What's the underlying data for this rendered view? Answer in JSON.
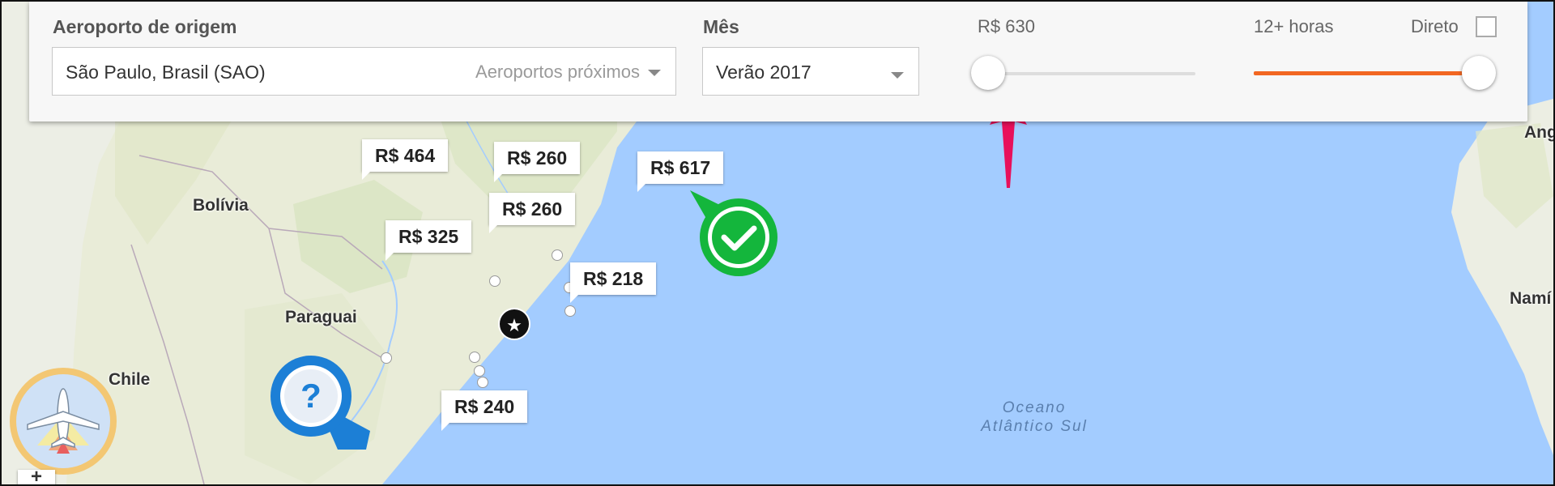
{
  "filters": {
    "origin_label": "Aeroporto de origem",
    "origin_value": "São Paulo, Brasil (SAO)",
    "nearby_airports": "Aeroportos próximos",
    "month_label": "Mês",
    "month_value": "Verão 2017",
    "price_label": "R$ 630",
    "price_slider_fraction": 0.05,
    "duration_label": "12+ horas",
    "duration_slider_fraction": 1.0,
    "direct_label": "Direto",
    "direct_checked": false
  },
  "map": {
    "countries": [
      "Bolívia",
      "Paraguai",
      "Chile",
      "Ang",
      "Namí"
    ],
    "ocean_line1": "Oceano",
    "ocean_line2": "Atlântico Sul",
    "price_tags": [
      "R$ 464",
      "R$ 260",
      "R$ 260",
      "R$ 325",
      "R$ 617",
      "R$ 218",
      "R$ 240"
    ],
    "zoom_in": "+"
  },
  "colors": {
    "accent_orange": "#f26722",
    "arrow_pink": "#e8105a",
    "check_green": "#14b63c",
    "question_blue": "#1c7fd6",
    "ocean": "#a3ccff"
  },
  "icons": {
    "selected_marker": "check-icon",
    "unknown_marker": "question-icon",
    "home_marker": "star-icon",
    "mode_badge": "airplane-icon"
  }
}
